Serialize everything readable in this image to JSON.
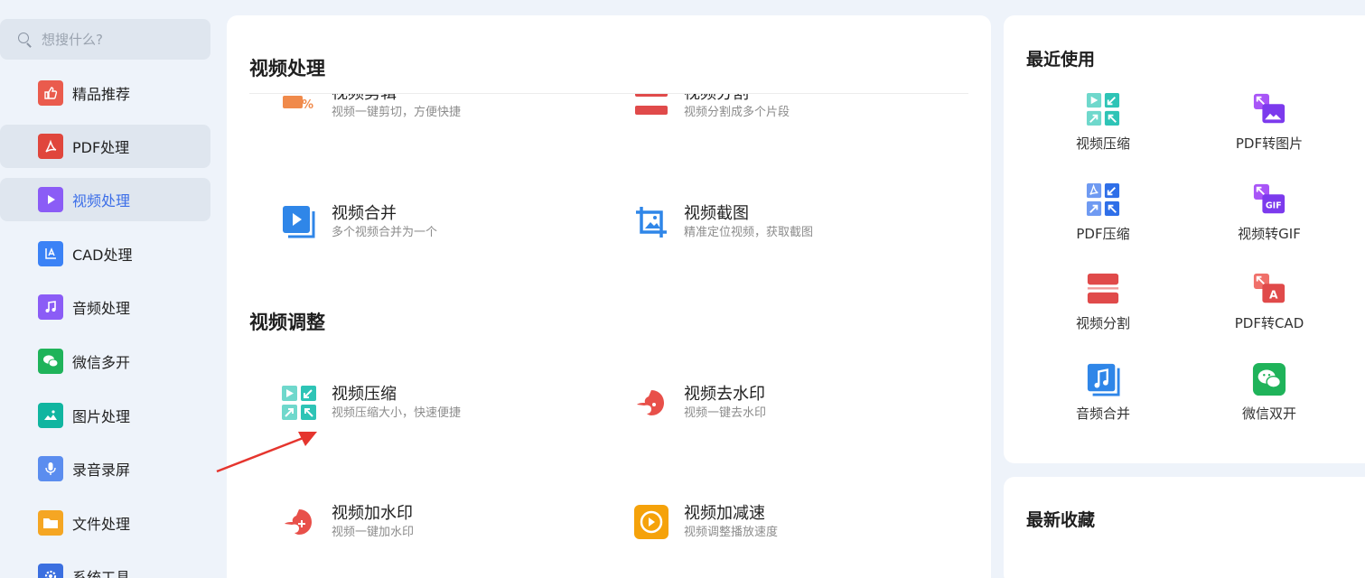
{
  "search": {
    "placeholder": "想搜什么?"
  },
  "sidebar": {
    "items": [
      {
        "label": "精品推荐",
        "icon": "thumbs-up-icon",
        "color": "#ea5b4d"
      },
      {
        "label": "PDF处理",
        "icon": "pdf-icon",
        "color": "#e0463c"
      },
      {
        "label": "视频处理",
        "icon": "video-play-icon",
        "color": "#8b5cf6"
      },
      {
        "label": "CAD处理",
        "icon": "cad-icon",
        "color": "#3b82f6"
      },
      {
        "label": "音频处理",
        "icon": "music-note-icon",
        "color": "#8b5cf6"
      },
      {
        "label": "微信多开",
        "icon": "wechat-icon",
        "color": "#1fb35a"
      },
      {
        "label": "图片处理",
        "icon": "image-icon",
        "color": "#10b5a0"
      },
      {
        "label": "录音录屏",
        "icon": "microphone-icon",
        "color": "#5b8def"
      },
      {
        "label": "文件处理",
        "icon": "folder-icon",
        "color": "#f5a623"
      },
      {
        "label": "系统工具",
        "icon": "gear-icon",
        "color": "#3b6fe0"
      }
    ],
    "active_index": 2
  },
  "main": {
    "section_video_processing": "视频处理",
    "section_video_adjust": "视频调整",
    "tools_partial": [
      {
        "name": "视频剪辑",
        "desc": "视频一键剪切，方便快捷",
        "icon": "video-cut-icon"
      },
      {
        "name": "视频分割",
        "desc": "视频分割成多个片段",
        "icon": "video-split-icon"
      }
    ],
    "tools_processing": [
      {
        "name": "视频合并",
        "desc": "多个视频合并为一个",
        "icon": "video-merge-icon"
      },
      {
        "name": "视频截图",
        "desc": "精准定位视频，获取截图",
        "icon": "crop-screenshot-icon"
      }
    ],
    "tools_adjust": [
      {
        "name": "视频压缩",
        "desc": "视频压缩大小，快速便捷",
        "icon": "compress-icon"
      },
      {
        "name": "视频去水印",
        "desc": "视频一键去水印",
        "icon": "remove-watermark-icon"
      },
      {
        "name": "视频加水印",
        "desc": "视频一键加水印",
        "icon": "add-watermark-icon"
      },
      {
        "name": "视频加减速",
        "desc": "视频调整播放速度",
        "icon": "speed-icon"
      }
    ]
  },
  "recent": {
    "title": "最近使用",
    "items": [
      {
        "label": "视频压缩",
        "icon": "compress-icon"
      },
      {
        "label": "PDF转图片",
        "icon": "pdf-to-image-icon"
      },
      {
        "label": "PDF压缩",
        "icon": "pdf-compress-icon"
      },
      {
        "label": "视频转GIF",
        "icon": "video-to-gif-icon"
      },
      {
        "label": "视频分割",
        "icon": "video-split-icon"
      },
      {
        "label": "PDF转CAD",
        "icon": "pdf-to-cad-icon"
      },
      {
        "label": "音频合并",
        "icon": "audio-merge-icon"
      },
      {
        "label": "微信双开",
        "icon": "wechat-icon"
      }
    ]
  },
  "favorites": {
    "title": "最新收藏"
  },
  "colors": {
    "accent": "#3d6fe8",
    "background": "#eef3fa",
    "highlight": "#dfe6ef",
    "teal": "#2ec4b6",
    "red": "#e04a4a",
    "orange": "#f5a20a",
    "purple": "#8b5cf6"
  }
}
